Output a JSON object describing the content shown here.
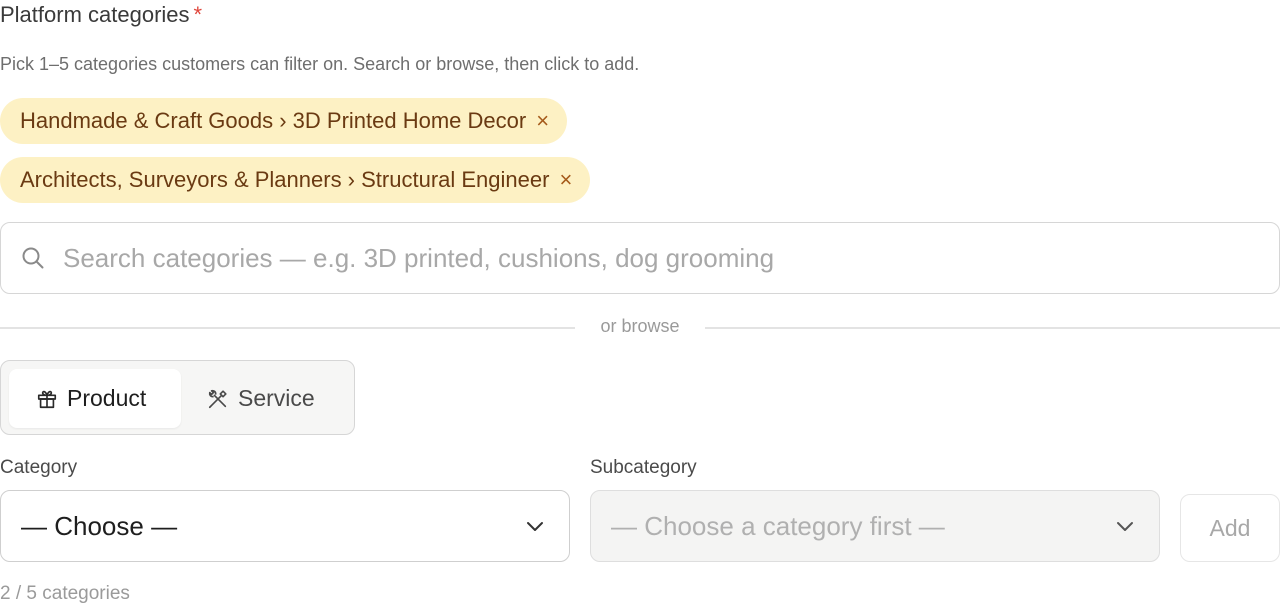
{
  "field": {
    "title": "Platform categories",
    "required_marker": "*",
    "helper": "Pick 1–5 categories customers can filter on. Search or browse, then click to add."
  },
  "selected": [
    {
      "label": "Handmade & Craft Goods › 3D Printed Home Decor",
      "remove": "×"
    },
    {
      "label": "Architects, Surveyors & Planners › Structural Engineer",
      "remove": "×"
    }
  ],
  "search": {
    "placeholder": "Search categories — e.g. 3D printed, cushions, dog grooming",
    "value": "",
    "icon": "search-icon"
  },
  "divider": {
    "label": "or browse"
  },
  "type_toggle": {
    "options": [
      {
        "label": "Product",
        "icon": "gift-icon",
        "active": true
      },
      {
        "label": "Service",
        "icon": "tools-icon",
        "active": false
      }
    ]
  },
  "category": {
    "label": "Category",
    "value": "— Choose —"
  },
  "subcategory": {
    "label": "Subcategory",
    "value": "— Choose a category first —",
    "disabled": true
  },
  "add_button": {
    "label": "Add",
    "disabled": true
  },
  "count": {
    "text": "2 / 5 categories"
  },
  "colors": {
    "chip_bg": "#fdf1c4",
    "chip_text": "#6a3a12",
    "required": "#e0453a"
  }
}
